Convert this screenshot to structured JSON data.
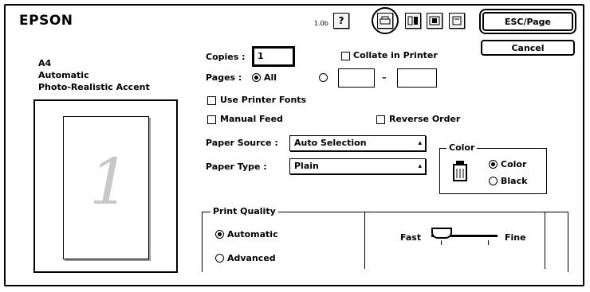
{
  "header": {
    "brand": "EPSON",
    "version": "1.0b",
    "toolbar_icons": [
      "help-icon",
      "printer-icon",
      "layout-icon",
      "utility-icon",
      "background-icon"
    ],
    "help_glyph": "?"
  },
  "buttons": {
    "esc_page": "ESC/Page",
    "cancel": "Cancel"
  },
  "summary": {
    "paper_size": "A4",
    "orientation": "Automatic",
    "mode": "Photo-Realistic Accent"
  },
  "preview": {
    "page_number": "1"
  },
  "copies": {
    "label": "Copies :",
    "value": "1"
  },
  "collate": {
    "label": "Collate in Printer",
    "checked": false
  },
  "pages": {
    "label": "Pages :",
    "all_label": "All",
    "all_selected": true,
    "from": "",
    "to": "",
    "separator": "–"
  },
  "options": {
    "use_printer_fonts": {
      "label": "Use Printer Fonts",
      "checked": false
    },
    "manual_feed": {
      "label": "Manual Feed",
      "checked": false
    },
    "reverse_order": {
      "label": "Reverse Order",
      "checked": false
    }
  },
  "paper_source": {
    "label": "Paper Source :",
    "value": "Auto Selection"
  },
  "paper_type": {
    "label": "Paper Type :",
    "value": "Plain"
  },
  "color_group": {
    "title": "Color",
    "options": [
      "Color",
      "Black"
    ],
    "selected": "Color"
  },
  "print_quality": {
    "title": "Print Quality",
    "options": [
      "Automatic",
      "Advanced"
    ],
    "selected": "Automatic",
    "slider": {
      "min_label": "Fast",
      "max_label": "Fine",
      "level": 0.0
    }
  }
}
